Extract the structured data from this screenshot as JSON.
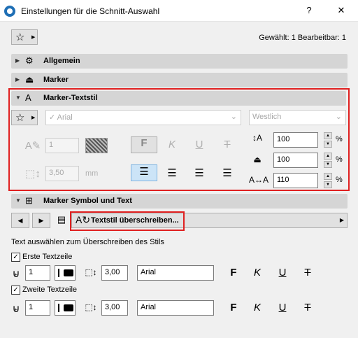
{
  "window": {
    "title": "Einstellungen für die Schnitt-Auswahl",
    "help": "?",
    "close": "✕"
  },
  "status": "Gewählt: 1 Bearbeitbar: 1",
  "sections": {
    "allgemein": "Allgemein",
    "marker": "Marker",
    "textstil": "Marker-Textstil",
    "symbol_text": "Marker Symbol und Text"
  },
  "textstil": {
    "font": "Arial",
    "script": "Westlich",
    "pen": "1",
    "size": "3,50",
    "size_unit": "mm",
    "width_factor": "100",
    "slant": "100",
    "spacing": "110",
    "percent": "%",
    "bold": "F",
    "italic": "K",
    "underline": "U",
    "strike": "T"
  },
  "override_button": "Textstil überschreiben...",
  "override_hint": "Text auswählen zum Überschreiben des Stils",
  "rows": [
    {
      "label": "Erste Textzeile",
      "pen": "1",
      "size": "3,00",
      "font": "Arial"
    },
    {
      "label": "Zweite Textzeile",
      "pen": "1",
      "size": "3,00",
      "font": "Arial"
    }
  ]
}
